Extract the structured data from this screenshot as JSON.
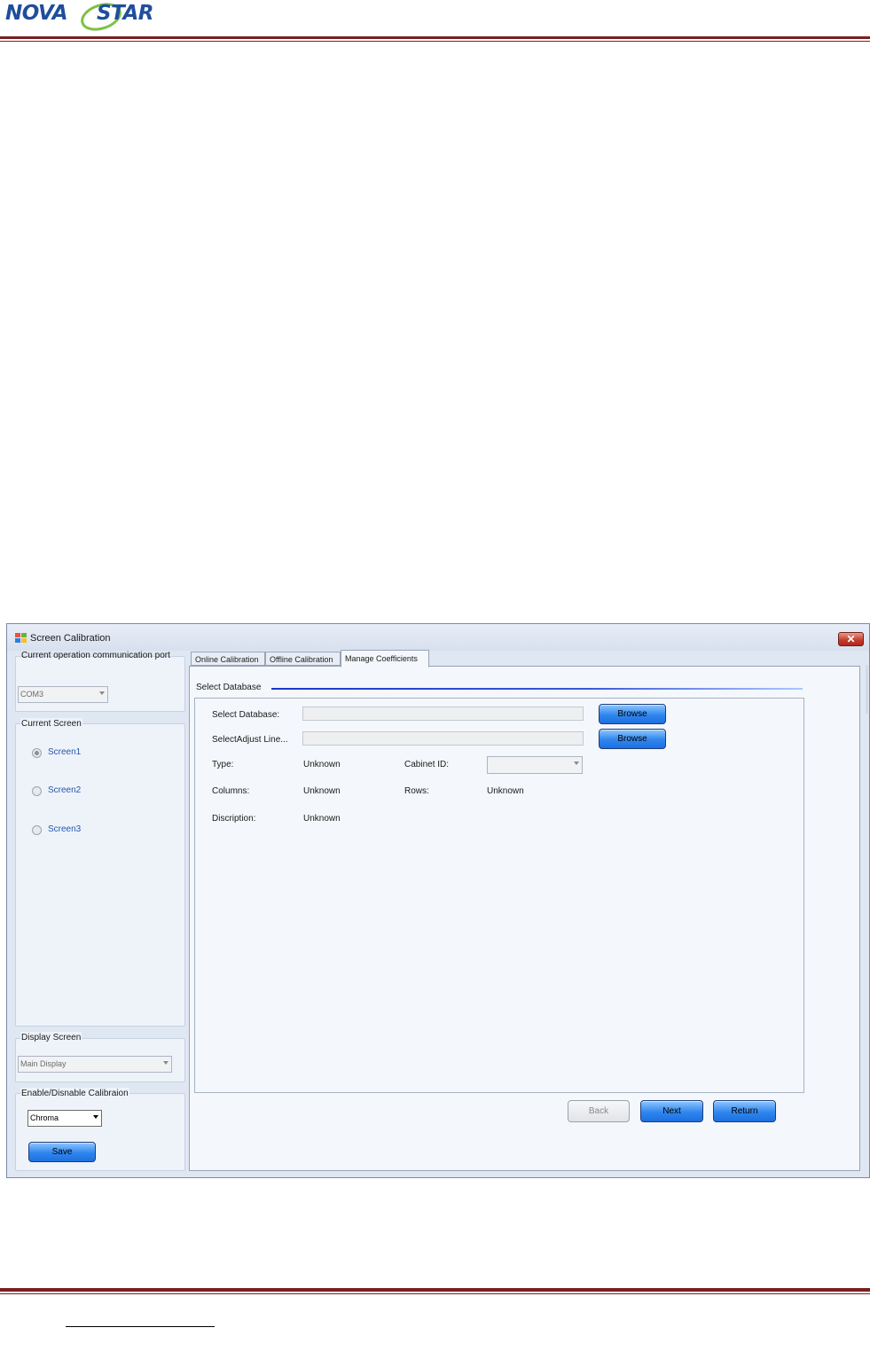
{
  "document": {
    "brand": {
      "part1": "NOVA",
      "part2": "STAR"
    }
  },
  "window": {
    "title": "Screen Calibration",
    "close_symbol": "✕"
  },
  "left_panel": {
    "comm": {
      "legend": "Current operation communication port",
      "port_value": "COM3"
    },
    "current_screen": {
      "legend": "Current Screen",
      "options": [
        "Screen1",
        "Screen2",
        "Screen3"
      ],
      "selected": "Screen1"
    },
    "display_screen": {
      "legend": "Display Screen",
      "value": "Main Display"
    },
    "calibration": {
      "legend": "Enable/Disnable Calibraion",
      "mode_value": "Chroma",
      "save_label": "Save"
    }
  },
  "tabs": [
    "Online Calibration",
    "Offline Calibration",
    "Manage Coefficients"
  ],
  "active_tab": "Manage Coefficients",
  "manage": {
    "section_title": "Select Database",
    "select_database_label": "Select Database:",
    "select_adjust_label": "SelectAdjust Line...",
    "browse_label": "Browse",
    "type_label": "Type:",
    "type_value": "Unknown",
    "cabinet_label": "Cabinet ID:",
    "cabinet_value": "",
    "columns_label": "Columns:",
    "columns_value": "Unknown",
    "rows_label": "Rows:",
    "rows_value": "Unknown",
    "description_label": "Discription:",
    "description_value": "Unknown"
  },
  "footer_buttons": {
    "back": "Back",
    "next": "Next",
    "return": "Return"
  },
  "colors": {
    "accent": "#2f86ee",
    "rule": "#7b1f1f",
    "logo": "#1f4e9c",
    "swoosh": "#7cc243"
  },
  "icons": {
    "app": "app-windows-icon",
    "close": "close-icon",
    "dropdown": "chevron-down-icon",
    "radio": "radio-icon"
  }
}
